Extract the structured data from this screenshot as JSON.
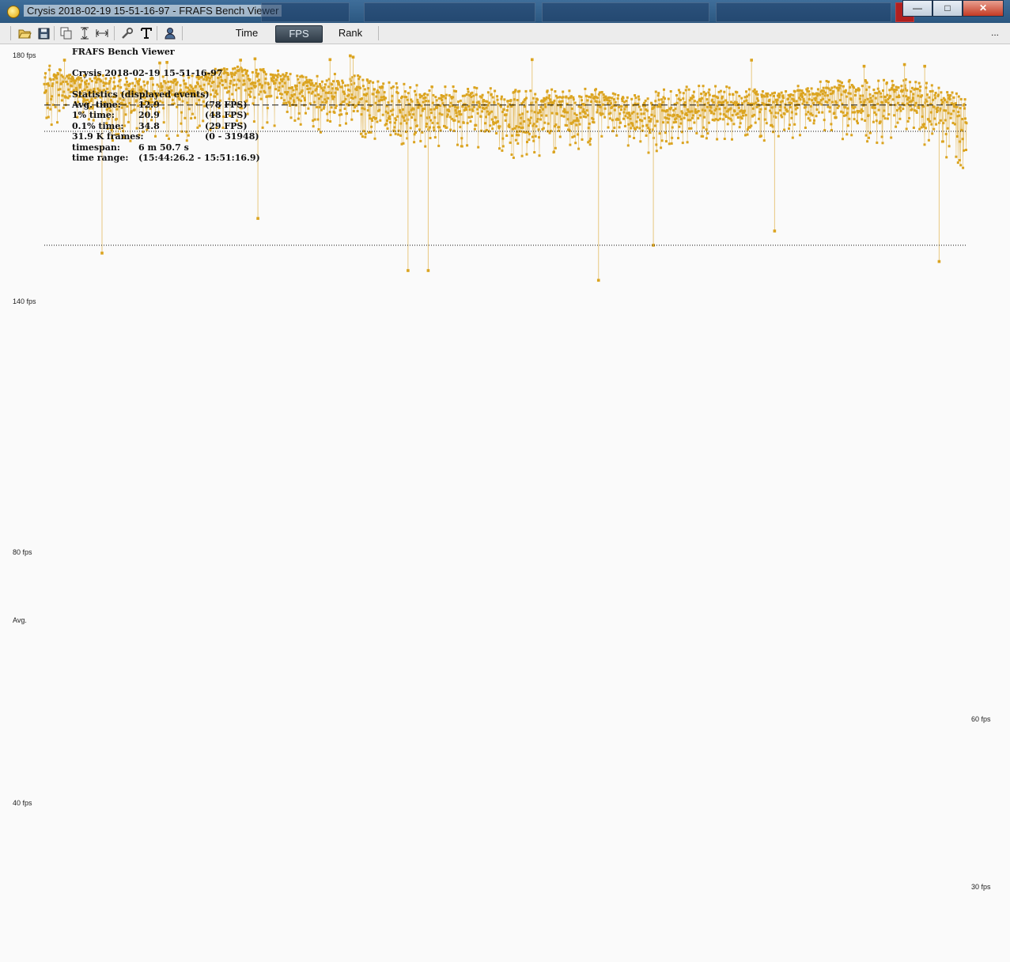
{
  "window": {
    "title": "Crysis 2018-02-19 15-51-16-97 - FRAFS Bench Viewer",
    "controls": {
      "minimize": "—",
      "maximize": "□",
      "close": "✕"
    }
  },
  "toolbar": {
    "icons": [
      "open-folder-icon",
      "save-icon",
      "copy-icon",
      "fit-vertical-icon",
      "fit-horizontal-icon",
      "settings-wrench-icon",
      "text-icon",
      "user-icon"
    ],
    "tabs": [
      {
        "label": "Time",
        "active": false
      },
      {
        "label": "FPS",
        "active": true
      },
      {
        "label": "Rank",
        "active": false
      }
    ],
    "more": "..."
  },
  "stats": {
    "app_title": "FRAFS Bench Viewer",
    "run_name": "Crysis 2018-02-19 15-51-16-97",
    "heading": "Statistics (displayed events)",
    "rows": [
      {
        "label": "Avg. time:",
        "value": "12.9",
        "extra": "(78 FPS)"
      },
      {
        "label": "1% time:",
        "value": "20.9",
        "extra": "(48 FPS)"
      },
      {
        "label": "0.1% time:",
        "value": "34.8",
        "extra": "(29 FPS)"
      },
      {
        "label": "31.9 K frames:",
        "value": "",
        "extra": "(0 - 31948)"
      },
      {
        "label": "timespan:",
        "value": "6 m 50.7 s",
        "extra": ""
      },
      {
        "label": "time range:",
        "value": "(15:44:26.2 - 15:51:16.9)",
        "extra": ""
      }
    ]
  },
  "axis": {
    "labels": {
      "fps180": "180 fps",
      "fps140": "140 fps",
      "fps80": "80 fps",
      "avg": "Avg.",
      "fps60": "60 fps",
      "fps40": "40 fps",
      "fps30": "30 fps"
    }
  },
  "colors": {
    "accent": "#dba420",
    "line": "#e8c880",
    "background": "#fafafa",
    "toolbar": "#ececec"
  },
  "chart_data": {
    "type": "scatter",
    "title": "",
    "xlabel": "",
    "ylabel": "",
    "x_range": [
      0,
      31948
    ],
    "ylim": [
      26,
      180
    ],
    "y_scale": "reciprocal (frame time)",
    "ticks_left": [
      180,
      140,
      80,
      40
    ],
    "ticks_right": [
      60,
      30
    ],
    "reference_lines": [
      {
        "name": "Avg.",
        "value": 78,
        "style": "dashed"
      },
      {
        "name": "60 fps",
        "value": 60,
        "style": "dotted"
      },
      {
        "name": "30 fps",
        "value": 30,
        "style": "dotted"
      }
    ],
    "series": [
      {
        "envelope": [
          {
            "x": 0,
            "low": 55,
            "mid": 95,
            "high": 150
          },
          {
            "x": 1000,
            "low": 58,
            "mid": 100,
            "high": 120
          },
          {
            "x": 2500,
            "low": 55,
            "mid": 93,
            "high": 118
          },
          {
            "x": 4000,
            "low": 55,
            "mid": 88,
            "high": 115
          },
          {
            "x": 5000,
            "low": 55,
            "mid": 95,
            "high": 120
          },
          {
            "x": 6500,
            "low": 62,
            "mid": 115,
            "high": 140
          },
          {
            "x": 7500,
            "low": 62,
            "mid": 105,
            "high": 135
          },
          {
            "x": 9000,
            "low": 60,
            "mid": 92,
            "high": 118
          },
          {
            "x": 10500,
            "low": 58,
            "mid": 88,
            "high": 122
          },
          {
            "x": 12000,
            "low": 52,
            "mid": 76,
            "high": 105
          },
          {
            "x": 13500,
            "low": 50,
            "mid": 74,
            "high": 100
          },
          {
            "x": 15000,
            "low": 50,
            "mid": 75,
            "high": 98
          },
          {
            "x": 16500,
            "low": 48,
            "mid": 70,
            "high": 95
          },
          {
            "x": 18000,
            "low": 50,
            "mid": 73,
            "high": 95
          },
          {
            "x": 19500,
            "low": 55,
            "mid": 78,
            "high": 97
          },
          {
            "x": 21000,
            "low": 50,
            "mid": 70,
            "high": 92
          },
          {
            "x": 22500,
            "low": 55,
            "mid": 78,
            "high": 102
          },
          {
            "x": 24000,
            "low": 55,
            "mid": 80,
            "high": 98
          },
          {
            "x": 25500,
            "low": 55,
            "mid": 80,
            "high": 95
          },
          {
            "x": 27000,
            "low": 55,
            "mid": 82,
            "high": 108
          },
          {
            "x": 28500,
            "low": 55,
            "mid": 82,
            "high": 110
          },
          {
            "x": 30000,
            "low": 52,
            "mid": 80,
            "high": 112
          },
          {
            "x": 31948,
            "low": 45,
            "mid": 72,
            "high": 85
          }
        ],
        "spikes": [
          {
            "x": 700,
            "value": 160
          },
          {
            "x": 4000,
            "value": 150
          },
          {
            "x": 4250,
            "value": 152
          },
          {
            "x": 6800,
            "value": 160
          },
          {
            "x": 7300,
            "value": 165
          },
          {
            "x": 9900,
            "value": 162
          },
          {
            "x": 10600,
            "value": 178
          },
          {
            "x": 10700,
            "value": 172
          },
          {
            "x": 16900,
            "value": 162
          },
          {
            "x": 24500,
            "value": 160
          },
          {
            "x": 28400,
            "value": 140
          },
          {
            "x": 29800,
            "value": 145
          },
          {
            "x": 30500,
            "value": 140
          }
        ],
        "dips": [
          {
            "x": 2000,
            "value": 29
          },
          {
            "x": 7400,
            "value": 34
          },
          {
            "x": 12600,
            "value": 27
          },
          {
            "x": 13300,
            "value": 27
          },
          {
            "x": 19200,
            "value": 26
          },
          {
            "x": 21100,
            "value": 30
          },
          {
            "x": 25300,
            "value": 32
          },
          {
            "x": 31000,
            "value": 28
          }
        ]
      }
    ]
  }
}
